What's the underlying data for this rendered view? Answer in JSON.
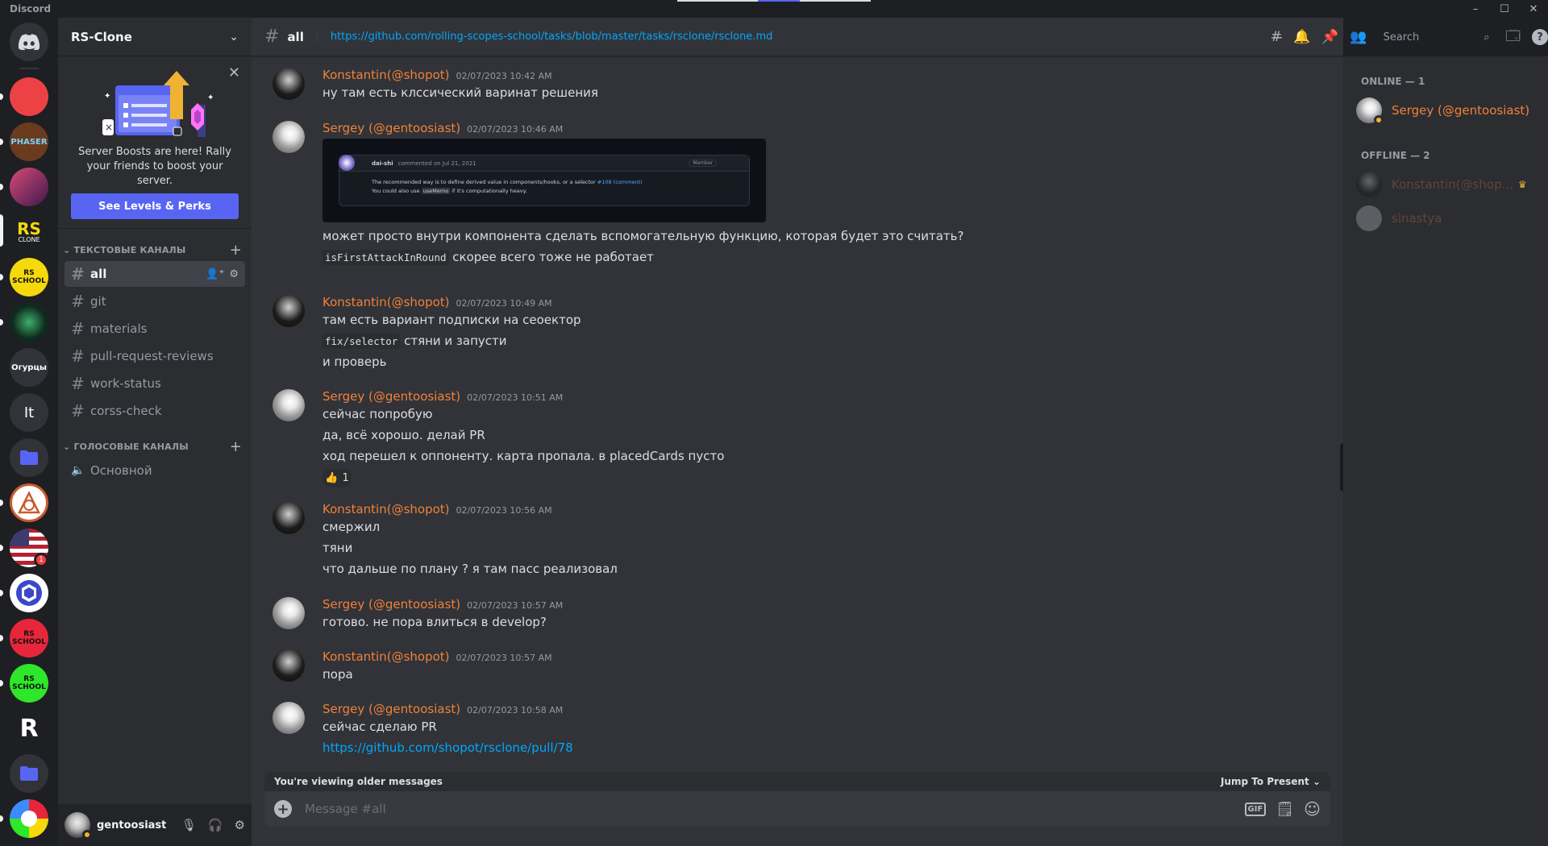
{
  "app": {
    "title": "Discord"
  },
  "rail": {
    "servers": [
      {
        "label": "",
        "color": "#ed4245"
      },
      {
        "label": "PHASER",
        "color": "#6b3b1e"
      },
      {
        "label": "",
        "color": "#8b2a5a"
      },
      {
        "label": "RS",
        "sublabel": "CLONE",
        "color": "#1e1f22"
      },
      {
        "label": "RS SCHOOL",
        "color": "#f5d90a"
      },
      {
        "label": "",
        "color": "#0f2a1e"
      },
      {
        "label": "Огурцы",
        "color": "#313338"
      },
      {
        "label": "It",
        "color": "#313338"
      },
      {
        "label": "",
        "color": "#313338"
      },
      {
        "label": "",
        "color": "#c75c2c"
      },
      {
        "label": "",
        "color": "#3c5aa8",
        "badge": "1"
      },
      {
        "label": "",
        "color": "#ffffff"
      },
      {
        "label": "RS SCHOOL",
        "color": "#e8263b"
      },
      {
        "label": "RS SCHOOL",
        "color": "#2ee62a"
      },
      {
        "label": "R",
        "color": "#1e1f22"
      },
      {
        "label": "",
        "color": "#313338"
      },
      {
        "label": "",
        "color": "#ffffff"
      }
    ]
  },
  "guild": {
    "name": "RS-Clone"
  },
  "boost": {
    "text": "Server Boosts are here! Rally your friends to boost your server.",
    "button": "See Levels & Perks"
  },
  "text_category": "Текстовые каналы",
  "voice_category": "Голосовые каналы",
  "text_channels": [
    "all",
    "git",
    "materials",
    "pull-request-reviews",
    "work-status",
    "corss-check"
  ],
  "voice_channels": [
    "Основной"
  ],
  "user": {
    "name": "gentoosiast"
  },
  "header": {
    "channel": "all",
    "topic": "https://github.com/rolling-scopes-school/tasks/blob/master/tasks/rsclone/rsclone.md",
    "search_placeholder": "Search"
  },
  "messages": [
    {
      "author": "Konstantin(@shopot)",
      "time": "02/07/2023 10:42 AM",
      "lines": [
        "ну там есть клссический варинат решения"
      ]
    },
    {
      "author": "Sergey (@gentoosiast)",
      "time": "02/07/2023 10:46 AM",
      "embed": {
        "user": "dai-shi",
        "meta": "commented on Jul 21, 2021",
        "role": "Member",
        "body1": "The recommended way is to define derived value in components/hooks, or a selector",
        "ref": "#108 (comment)",
        "body2a": "You could also use",
        "code": "useMemo",
        "body2b": "if it's computationally heavy."
      },
      "lines": [
        "может просто внутри компонента сделать вспомогательную функцию, которая будет это считать?"
      ],
      "code_line": {
        "code": "isFirstAttackInRound",
        "text": " скорее всего тоже не работает"
      }
    },
    {
      "author": "Konstantin(@shopot)",
      "time": "02/07/2023 10:49 AM",
      "lines": [
        "там есть вариант подписки на сеоектор"
      ],
      "code_line": {
        "code": "fix/selector",
        "text": " стяни и запусти"
      },
      "lines2": [
        "и проверь"
      ]
    },
    {
      "author": "Sergey (@gentoosiast)",
      "time": "02/07/2023 10:51 AM",
      "lines": [
        "сейчас попробую",
        "да, всё хорошо. делай PR",
        "ход перешел к оппоненту. карта пропала. в placedCards пусто"
      ],
      "reaction": {
        "emoji": "👍",
        "count": "1"
      }
    },
    {
      "author": "Konstantin(@shopot)",
      "time": "02/07/2023 10:56 AM",
      "lines": [
        "смержил",
        "тяни",
        "что дальше по плану ? я там пасс реализовал"
      ]
    },
    {
      "author": "Sergey (@gentoosiast)",
      "time": "02/07/2023 10:57 AM",
      "lines": [
        "готово. не пора влиться в develop?"
      ]
    },
    {
      "author": "Konstantin(@shopot)",
      "time": "02/07/2023 10:57 AM",
      "lines": [
        "пора"
      ]
    },
    {
      "author": "Sergey (@gentoosiast)",
      "time": "02/07/2023 10:58 AM",
      "lines": [
        "сейчас сделаю PR"
      ],
      "link": "https://github.com/shopot/rsclone/pull/78"
    }
  ],
  "older_bar": {
    "text": "You're viewing older messages",
    "jump": "Jump To Present"
  },
  "composer": {
    "placeholder": "Message #all",
    "gif": "GIF"
  },
  "members": {
    "online_label": "ONLINE — 1",
    "offline_label": "OFFLINE — 2",
    "online": [
      {
        "name": "Sergey (@gentoosiast)"
      }
    ],
    "offline": [
      {
        "name": "Konstantin(@shop..."
      },
      {
        "name": "sinastya"
      }
    ]
  },
  "colors": {
    "accent": "#5865f2",
    "author": "#f0813a",
    "link": "#00a8fc",
    "idle": "#f0b232"
  }
}
